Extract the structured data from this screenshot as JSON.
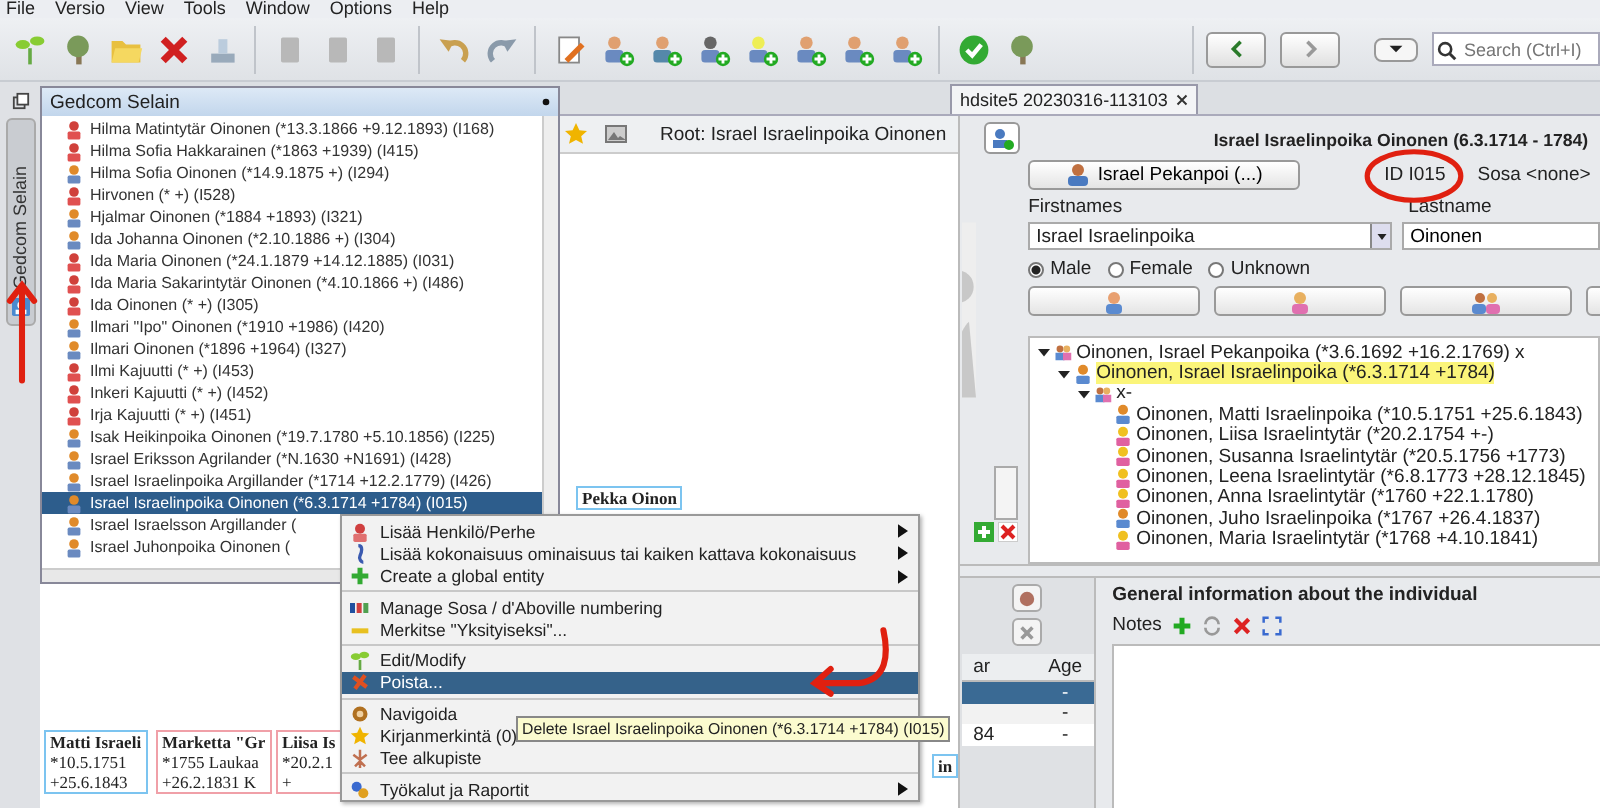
{
  "menu_bar": [
    "File",
    "Versio",
    "View",
    "Tools",
    "Window",
    "Options",
    "Help"
  ],
  "search": {
    "placeholder": "Search (Ctrl+I)"
  },
  "side_tab": {
    "label": "Gedcom Selain"
  },
  "document_tab": {
    "label": "hdsite5 20230316-113103"
  },
  "root_label": "Root: Israel Israelinpoika Oinonen",
  "chart_nodes": [
    {
      "lines": [
        "Pekka Oinon"
      ],
      "kind": "male"
    },
    {
      "lines": [
        "Matti Israeli",
        "*10.5.1751",
        "+25.6.1843"
      ],
      "kind": "male"
    },
    {
      "lines": [
        "Marketta \"Gr",
        "*1755 Laukaa",
        "+26.2.1831 K"
      ],
      "kind": "female"
    },
    {
      "lines": [
        "Liisa Is",
        "*20.2.1",
        "+"
      ],
      "kind": "female"
    },
    {
      "lines": [
        "in"
      ],
      "kind": "male"
    }
  ],
  "browser_popup": {
    "title": "Gedcom Selain",
    "items": [
      {
        "label": "Hilma Matintytär Oinonen (*13.3.1866 +9.12.1893) (I168)",
        "kind": "female",
        "selected": false
      },
      {
        "label": "Hilma Sofia Hakkarainen (*1863 +1939) (I415)",
        "kind": "female",
        "selected": false
      },
      {
        "label": "Hilma Sofia Oinonen (*14.9.1875 +) (I294)",
        "kind": "male",
        "selected": false
      },
      {
        "label": "Hirvonen (* +) (I528)",
        "kind": "female",
        "selected": false
      },
      {
        "label": "Hjalmar Oinonen (*1884 +1893) (I321)",
        "kind": "male",
        "selected": false
      },
      {
        "label": "Ida Johanna Oinonen (*2.10.1886 +) (I304)",
        "kind": "male",
        "selected": false
      },
      {
        "label": "Ida Maria Oinonen (*24.1.1879 +14.12.1885) (I031)",
        "kind": "female",
        "selected": false
      },
      {
        "label": "Ida Maria Sakarintytär Oinonen (*4.10.1866 +) (I486)",
        "kind": "female",
        "selected": false
      },
      {
        "label": "Ida Oinonen (* +) (I305)",
        "kind": "female",
        "selected": false
      },
      {
        "label": "Ilmari \"Ipo\" Oinonen (*1910 +1986) (I420)",
        "kind": "male",
        "selected": false
      },
      {
        "label": "Ilmari Oinonen (*1896 +1964) (I327)",
        "kind": "male",
        "selected": false
      },
      {
        "label": "Ilmi Kajuutti (* +) (I453)",
        "kind": "female",
        "selected": false
      },
      {
        "label": "Inkeri Kajuutti (* +) (I452)",
        "kind": "female",
        "selected": false
      },
      {
        "label": "Irja Kajuutti (* +) (I451)",
        "kind": "female",
        "selected": false
      },
      {
        "label": "Isak Heikinpoika Oinonen (*19.7.1780 +5.10.1856) (I225)",
        "kind": "male",
        "selected": false
      },
      {
        "label": "Israel Eriksson Agrilander (*N.1630 +N1691) (I428)",
        "kind": "male",
        "selected": false
      },
      {
        "label": "Israel Israelinpoika Argillander (*1714 +12.2.1779) (I426)",
        "kind": "male",
        "selected": false
      },
      {
        "label": "Israel Israelinpoika Oinonen (*6.3.1714 +1784) (I015)",
        "kind": "male",
        "selected": true
      },
      {
        "label": "Israel Israelsson Argillander (",
        "kind": "male",
        "selected": false
      },
      {
        "label": "Israel Juhonpoika Oinonen (",
        "kind": "male",
        "selected": false
      }
    ]
  },
  "individual": {
    "title": "Israel Israelinpoika Oinonen (6.3.1714 - 1784)",
    "father_button": "Israel Pekanpoi (...)",
    "id": "ID I015",
    "sosa": "Sosa <none>",
    "firstnames_label": "Firstnames",
    "firstnames": "Israel Israelinpoika",
    "lastname_label": "Lastname",
    "lastname": "Oinonen",
    "sex_options": [
      {
        "label": "Male",
        "selected": true
      },
      {
        "label": "Female",
        "selected": false
      },
      {
        "label": "Unknown",
        "selected": false
      }
    ],
    "tree": [
      {
        "label": "Oinonen, Israel Pekanpoika (*3.6.1692 +16.2.1769) x",
        "kind": "family",
        "expanded": true,
        "selected": false,
        "children": [
          {
            "label": "Oinonen, Israel Israelinpoika (*6.3.1714 +1784)",
            "kind": "male",
            "expanded": true,
            "selected": true,
            "children": [
              {
                "label": "x-",
                "kind": "family",
                "expanded": true,
                "selected": false,
                "children": [
                  {
                    "label": "Oinonen, Matti Israelinpoika (*10.5.1751 +25.6.1843)",
                    "kind": "male",
                    "selected": false
                  },
                  {
                    "label": "Oinonen, Liisa Israelintytär (*20.2.1754 +-)",
                    "kind": "female",
                    "selected": false
                  },
                  {
                    "label": "Oinonen, Susanna Israelintytär (*20.5.1756 +1773)",
                    "kind": "female",
                    "selected": false
                  },
                  {
                    "label": "Oinonen, Leena Israelintytär (*6.8.1773 +28.12.1845)",
                    "kind": "female",
                    "selected": false
                  },
                  {
                    "label": "Oinonen, Anna Israelintytär (*1760 +22.1.1780)",
                    "kind": "female",
                    "selected": false
                  },
                  {
                    "label": "Oinonen, Juho Israelinpoika (*1767 +26.4.1837)",
                    "kind": "male",
                    "selected": false
                  },
                  {
                    "label": "Oinonen, Maria Israelintytär (*1768 +4.10.1841)",
                    "kind": "female",
                    "selected": false
                  }
                ]
              }
            ]
          }
        ]
      }
    ]
  },
  "events_table": {
    "columns": [
      "ar",
      "Age"
    ],
    "rows": [
      {
        "age": "-",
        "selected": true
      },
      {
        "age": "-",
        "selected": false
      },
      {
        "year": "84",
        "age": "-",
        "selected": false
      }
    ]
  },
  "general_info": {
    "title": "General information about the individual",
    "notes_label": "Notes"
  },
  "context_menu": {
    "groups": [
      [
        {
          "label": "Lisää Henkilö/Perhe",
          "kind": "person",
          "submenu": true,
          "selected": false
        },
        {
          "label": "Lisää kokonaisuus ominaisuus tai kaiken kattava kokonaisuus",
          "kind": "entity",
          "submenu": true,
          "selected": false
        },
        {
          "label": "Create a global entity",
          "kind": "plus",
          "submenu": true,
          "selected": false
        }
      ],
      [
        {
          "label": "Manage Sosa / d'Aboville numbering",
          "kind": "numbering",
          "submenu": false,
          "selected": false
        },
        {
          "label": "Merkitse \"Yksityiseksi\"...",
          "kind": "private",
          "submenu": false,
          "selected": false
        }
      ],
      [
        {
          "label": "Edit/Modify",
          "kind": "edit",
          "submenu": false,
          "selected": false
        },
        {
          "label": "Poista...",
          "kind": "delete",
          "submenu": false,
          "selected": true
        }
      ],
      [
        {
          "label": "Navigoida",
          "kind": "gear",
          "submenu": false,
          "selected": false
        },
        {
          "label": "Kirjanmerkintä (0)",
          "kind": "star",
          "submenu": false,
          "selected": false
        },
        {
          "label": "Tee alkupiste",
          "kind": "root",
          "submenu": false,
          "selected": false
        }
      ],
      [
        {
          "label": "Työkalut ja Raportit",
          "kind": "tools",
          "submenu": true,
          "selected": false
        }
      ]
    ]
  },
  "tooltip": "Delete Israel Israelinpoika Oinonen (*6.3.1714 +1784) (I015)"
}
